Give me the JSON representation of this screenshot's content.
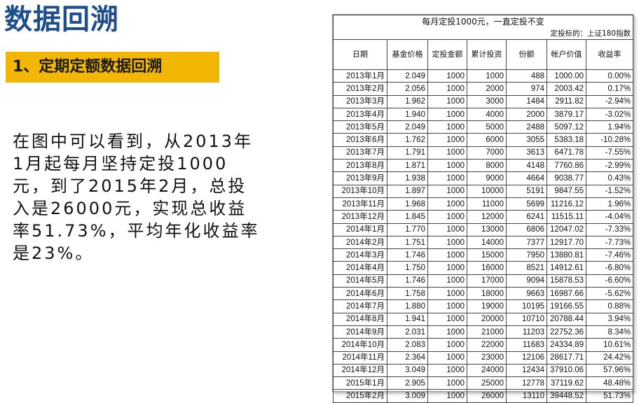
{
  "page": {
    "title": "数据回溯",
    "subtitle": "1、定期定额数据回溯",
    "description": "在图中可以看到，从2013年1月起每月坚持定投1000元，到了2015年2月，总投入是26000元，实现总收益率51.73%，平均年化收益率是23%。"
  },
  "table": {
    "title": "每月定投1000元，一直定投不变",
    "target_label": "定投标的：上证180指数",
    "headers": [
      "日期",
      "基金价格",
      "定投金额",
      "累计投资",
      "份额",
      "帐户价值",
      "收益率"
    ],
    "rows": [
      [
        "2013年1月",
        "2.049",
        "1000",
        "1000",
        "488",
        "1000.00",
        "0.00%"
      ],
      [
        "2013年2月",
        "2.056",
        "1000",
        "2000",
        "974",
        "2003.42",
        "0.17%"
      ],
      [
        "2013年3月",
        "1.962",
        "1000",
        "3000",
        "1484",
        "2911.82",
        "-2.94%"
      ],
      [
        "2013年4月",
        "1.940",
        "1000",
        "4000",
        "2000",
        "3879.17",
        "-3.02%"
      ],
      [
        "2013年5月",
        "2.049",
        "1000",
        "5000",
        "2488",
        "5097.12",
        "1.94%"
      ],
      [
        "2013年6月",
        "1.762",
        "1000",
        "6000",
        "3055",
        "5383.18",
        "-10.28%"
      ],
      [
        "2013年7月",
        "1.791",
        "1000",
        "7000",
        "3613",
        "6471.78",
        "-7.55%"
      ],
      [
        "2013年8月",
        "1.871",
        "1000",
        "8000",
        "4148",
        "7760.86",
        "-2.99%"
      ],
      [
        "2013年9月",
        "1.938",
        "1000",
        "9000",
        "4664",
        "9038.77",
        "0.43%"
      ],
      [
        "2013年10月",
        "1.897",
        "1000",
        "10000",
        "5191",
        "9847.55",
        "-1.52%"
      ],
      [
        "2013年11月",
        "1.968",
        "1000",
        "11000",
        "5699",
        "11216.12",
        "1.96%"
      ],
      [
        "2013年12月",
        "1.845",
        "1000",
        "12000",
        "6241",
        "11515.11",
        "-4.04%"
      ],
      [
        "2014年1月",
        "1.770",
        "1000",
        "13000",
        "6806",
        "12047.02",
        "-7.33%"
      ],
      [
        "2014年2月",
        "1.751",
        "1000",
        "14000",
        "7377",
        "12917.70",
        "-7.73%"
      ],
      [
        "2014年3月",
        "1.746",
        "1000",
        "15000",
        "7950",
        "13880.81",
        "-7.46%"
      ],
      [
        "2014年4月",
        "1.750",
        "1000",
        "16000",
        "8521",
        "14912.61",
        "-6.80%"
      ],
      [
        "2014年5月",
        "1.746",
        "1000",
        "17000",
        "9094",
        "15878.53",
        "-6.60%"
      ],
      [
        "2014年6月",
        "1.758",
        "1000",
        "18000",
        "9663",
        "16987.66",
        "-5.62%"
      ],
      [
        "2014年7月",
        "1.880",
        "1000",
        "19000",
        "10195",
        "19166.55",
        "0.88%"
      ],
      [
        "2014年8月",
        "1.941",
        "1000",
        "20000",
        "10710",
        "20788.44",
        "3.94%"
      ],
      [
        "2014年9月",
        "2.031",
        "1000",
        "21000",
        "11203",
        "22752.36",
        "8.34%"
      ],
      [
        "2014年10月",
        "2.083",
        "1000",
        "22000",
        "11683",
        "24334.89",
        "10.61%"
      ],
      [
        "2014年11月",
        "2.364",
        "1000",
        "23000",
        "12106",
        "28617.71",
        "24.42%"
      ],
      [
        "2014年12月",
        "3.049",
        "1000",
        "24000",
        "12434",
        "37910.06",
        "57.96%"
      ],
      [
        "2015年1月",
        "2.905",
        "1000",
        "25000",
        "12778",
        "37119.62",
        "48.48%"
      ],
      [
        "2015年2月",
        "3.009",
        "1000",
        "26000",
        "13110",
        "39448.52",
        "51.73%"
      ]
    ]
  },
  "colors": {
    "title": "#1f4e8c",
    "subtitle_bg": "#f2b705"
  }
}
